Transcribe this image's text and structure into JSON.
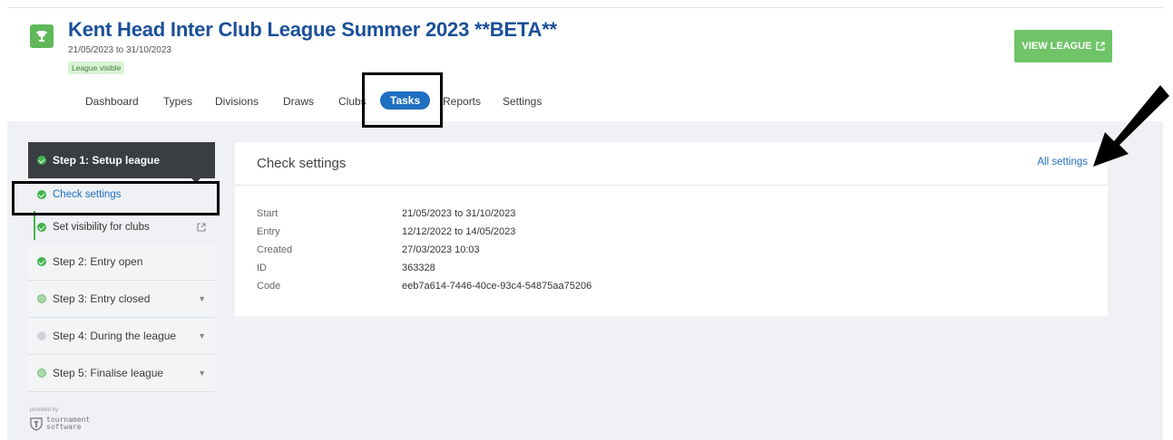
{
  "header": {
    "title": "Kent Head Inter Club League Summer 2023 **BETA**",
    "dates": "21/05/2023 to 31/10/2023",
    "visibility_badge": "League visible",
    "view_button": "VIEW LEAGUE",
    "trophy_icon": "trophy-icon",
    "external_icon": "external-link-icon"
  },
  "nav": {
    "items": [
      "Dashboard",
      "Types",
      "Divisions",
      "Draws",
      "Clubs",
      "Tasks",
      "Reports",
      "Settings"
    ],
    "active": "Tasks"
  },
  "sidebar": {
    "step1": "Step 1: Setup league",
    "substeps": [
      {
        "label": "Check settings",
        "status": "done",
        "active": true
      },
      {
        "label": "Set visibility for clubs",
        "status": "done",
        "active": false
      }
    ],
    "steps": [
      {
        "label": "Step 2: Entry open",
        "status": "done",
        "expandable": false
      },
      {
        "label": "Step 3: Entry closed",
        "status": "pending",
        "expandable": true
      },
      {
        "label": "Step 4: During the league",
        "status": "todo",
        "expandable": true
      },
      {
        "label": "Step 5: Finalise league",
        "status": "pending",
        "expandable": true
      }
    ]
  },
  "card": {
    "title": "Check settings",
    "link": "All settings",
    "rows": [
      {
        "key": "Start",
        "value": "21/05/2023 to 31/10/2023"
      },
      {
        "key": "Entry",
        "value": "12/12/2022 to 14/05/2023"
      },
      {
        "key": "Created",
        "value": "27/03/2023 10:03"
      },
      {
        "key": "ID",
        "value": "363328"
      },
      {
        "key": "Code",
        "value": "eeb7a614-7446-40ce-93c4-54875aa75206"
      }
    ]
  },
  "footer": {
    "provided_by": "provided by",
    "brand_line1": "tournament",
    "brand_line2": "software"
  },
  "colors": {
    "title_blue": "#1a4f98",
    "green": "#70c468",
    "active_pill": "#1f6fc0",
    "sidebar_dark": "#3a3d42"
  }
}
